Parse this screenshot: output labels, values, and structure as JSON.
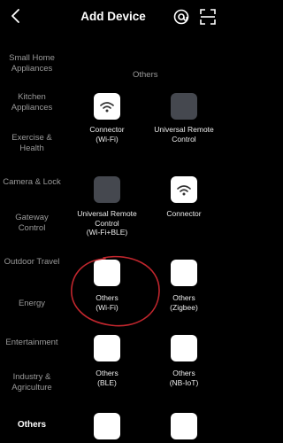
{
  "header": {
    "title": "Add Device"
  },
  "sidebar": {
    "items": [
      {
        "label": "Small Home\nAppliances"
      },
      {
        "label": "Kitchen\nAppliances"
      },
      {
        "label": "Exercise &\nHealth"
      },
      {
        "label": "Camera & Lock"
      },
      {
        "label": "Gateway\nControl"
      },
      {
        "label": "Outdoor Travel"
      },
      {
        "label": "Energy"
      },
      {
        "label": "Entertainment"
      },
      {
        "label": "Industry &\nAgriculture"
      },
      {
        "label": "Others",
        "active": true
      }
    ]
  },
  "main": {
    "section_title": "Others",
    "devices": [
      {
        "label": "Connector\n(Wi-Fi)",
        "icon": "wifi-icon"
      },
      {
        "label": "Universal Remote\nControl",
        "icon": "dark-square-icon"
      },
      {
        "label": "Universal Remote\nControl\n(Wi-Fi+BLE)",
        "icon": "dark-square-icon"
      },
      {
        "label": "Connector",
        "icon": "wifi-icon"
      },
      {
        "label": "Others\n(Wi-Fi)",
        "icon": "white-square-icon"
      },
      {
        "label": "Others\n(Zigbee)",
        "icon": "white-square-icon"
      },
      {
        "label": "Others\n(BLE)",
        "icon": "white-square-icon"
      },
      {
        "label": "Others\n(NB-IoT)",
        "icon": "white-square-icon"
      },
      {
        "label": "",
        "icon": "white-square-icon"
      },
      {
        "label": "",
        "icon": "white-square-icon"
      }
    ]
  },
  "colors": {
    "background": "#000000",
    "tile_light": "#ffffff",
    "tile_dark": "#45484f",
    "annotation": "#c0262d"
  }
}
